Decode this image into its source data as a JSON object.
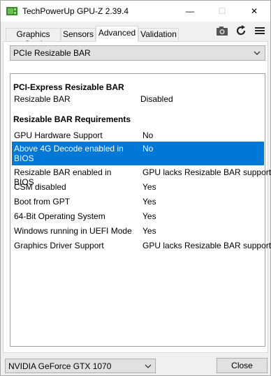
{
  "window": {
    "title": "TechPowerUp GPU-Z 2.39.4",
    "minimize_glyph": "—",
    "maximize_glyph": "☐",
    "close_glyph": "✕"
  },
  "tabs": [
    {
      "label": "Graphics Card",
      "active": false
    },
    {
      "label": "Sensors",
      "active": false
    },
    {
      "label": "Advanced",
      "active": true
    },
    {
      "label": "Validation",
      "active": false
    }
  ],
  "toolbar": {
    "icons": [
      "camera-icon",
      "refresh-icon",
      "hamburger-menu-icon"
    ]
  },
  "category_select": {
    "value": "PCIe Resizable BAR"
  },
  "sections": {
    "pcie": {
      "title": "PCI-Express Resizable BAR",
      "rows": [
        {
          "key": "Resizable BAR",
          "value": "Disabled"
        }
      ]
    },
    "requirements": {
      "title": "Resizable BAR Requirements",
      "rows": [
        {
          "key": "GPU Hardware Support",
          "value": "No"
        },
        {
          "key": "Above 4G Decode enabled in BIOS",
          "value": "No",
          "selected": true
        },
        {
          "key": "Resizable BAR enabled in BIOS",
          "value": "GPU lacks Resizable BAR support"
        },
        {
          "key": "CSM disabled",
          "value": "Yes"
        },
        {
          "key": "Boot from GPT",
          "value": "Yes"
        },
        {
          "key": "64-Bit Operating System",
          "value": "Yes"
        },
        {
          "key": "Windows running in UEFI Mode",
          "value": "Yes"
        },
        {
          "key": "Graphics Driver Support",
          "value": "GPU lacks Resizable BAR support"
        }
      ]
    }
  },
  "footer": {
    "gpu_select": "NVIDIA GeForce GTX 1070",
    "close_label": "Close"
  },
  "colors": {
    "selection": "#0078d7",
    "selection_text": "#ffffff"
  }
}
